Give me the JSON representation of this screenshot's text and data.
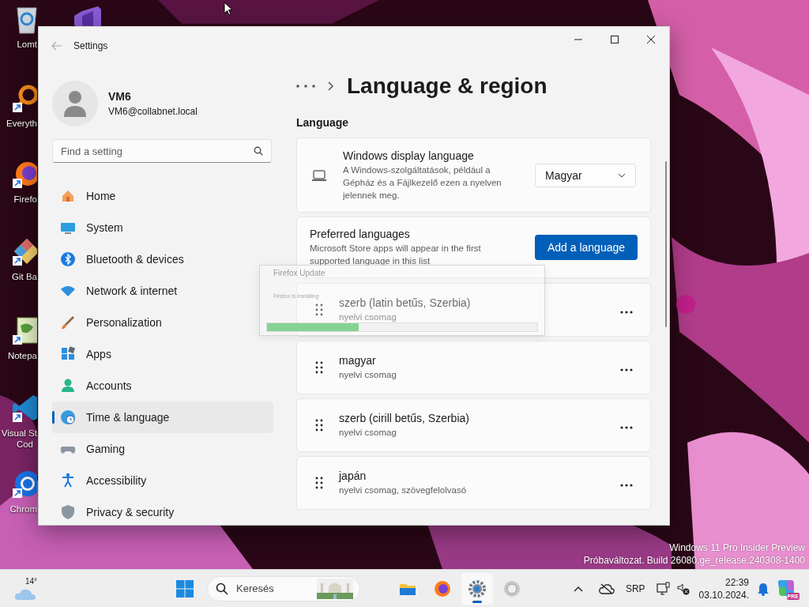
{
  "desktop_icons": [
    {
      "kind": "recycle-bin",
      "lines": [
        "Lomt"
      ]
    },
    {
      "kind": "visual-studio"
    },
    {
      "kind": "everything",
      "lines": [
        "Everyth"
      ]
    },
    {
      "kind": "firefox",
      "lines": [
        "Firefo"
      ]
    },
    {
      "kind": "git",
      "lines": [
        "Git Ba"
      ]
    },
    {
      "kind": "notepad",
      "lines": [
        "Notepa"
      ]
    },
    {
      "kind": "vscode",
      "lines": [
        "Visual St",
        "Cod"
      ]
    },
    {
      "kind": "chrome",
      "lines": [
        "Chrom"
      ]
    }
  ],
  "desktop_version_text": [
    "Windows 11 Pro Insider Preview",
    "Próbaváltozat. Build 26080.ge_release.240308-1400"
  ],
  "settings": {
    "title": "Settings",
    "user": {
      "name": "VM6",
      "email": "VM6@collabnet.local"
    },
    "search": {
      "placeholder": "Find a setting"
    },
    "nav": [
      {
        "kind": "home",
        "label": "Home",
        "selected": false
      },
      {
        "kind": "system",
        "label": "System",
        "selected": false
      },
      {
        "kind": "bluetooth",
        "label": "Bluetooth & devices",
        "selected": false
      },
      {
        "kind": "network",
        "label": "Network & internet",
        "selected": false
      },
      {
        "kind": "personalization",
        "label": "Personalization",
        "selected": false
      },
      {
        "kind": "apps",
        "label": "Apps",
        "selected": false
      },
      {
        "kind": "accounts",
        "label": "Accounts",
        "selected": false
      },
      {
        "kind": "time",
        "label": "Time & language",
        "selected": true
      },
      {
        "kind": "gaming",
        "label": "Gaming",
        "selected": false
      },
      {
        "kind": "accessibility",
        "label": "Accessibility",
        "selected": false
      },
      {
        "kind": "privacy",
        "label": "Privacy & security",
        "selected": false
      }
    ],
    "page_title": "Language & region",
    "section": "Language",
    "display_language": {
      "title": "Windows display language",
      "description": "A Windows-szolgáltatások, például a Gépház és a Fájlkezelő ezen a nyelven jelennek meg.",
      "value": "Magyar"
    },
    "preferred": {
      "title": "Preferred languages",
      "description": "Microsoft Store apps will appear in the first supported language in this list",
      "button": "Add a language"
    },
    "languages": [
      {
        "name": "szerb (latin betűs, Szerbia)",
        "detail": "nyelvi csomag"
      },
      {
        "name": "magyar",
        "detail": "nyelvi csomag"
      },
      {
        "name": "szerb (cirill betűs, Szerbia)",
        "detail": "nyelvi csomag"
      },
      {
        "name": "japán",
        "detail": "nyelvi csomag, szövegfelolvasó"
      }
    ]
  },
  "firefox_update": {
    "title": "Firefox Update",
    "message": "Firefox is installing",
    "level": 0.34
  },
  "taskbar": {
    "weather": "14°",
    "search_placeholder": "Keresés",
    "apps": [
      {
        "kind": "folder",
        "selected": false
      },
      {
        "kind": "firefox",
        "selected": false
      },
      {
        "kind": "settings",
        "selected": true
      },
      {
        "kind": "generic",
        "selected": false
      }
    ],
    "language": "SRP",
    "time": "22:39",
    "date": "03.10.2024.",
    "copilot_badge": "PRE"
  }
}
